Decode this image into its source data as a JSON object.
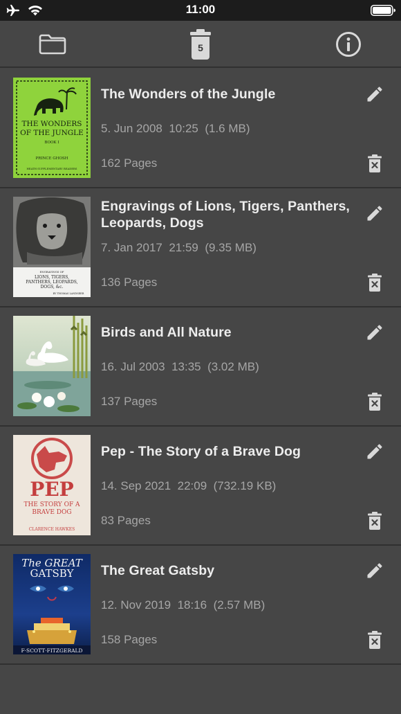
{
  "status_bar": {
    "time": "11:00",
    "icons": [
      "airplane-icon",
      "wifi-icon",
      "battery-icon"
    ]
  },
  "toolbar": {
    "folder_icon": "folder-icon",
    "trash_icon": "trash-icon",
    "trash_count": "5",
    "info_icon": "info-icon"
  },
  "books": [
    {
      "title": "The Wonders of the Jungle",
      "date": "5. Jun 2008",
      "time": "10:25",
      "size": "(1.6 MB)",
      "pages": "162 Pages",
      "cover": {
        "line1": "THE WONDERS",
        "line2": "OF THE JUNGLE",
        "line3": "BOOK I",
        "author": "PRINCE GHOSH",
        "footer": "HEATH SUPPLEMENTARY READERS"
      }
    },
    {
      "title": "Engravings of Lions, Tigers, Panthers, Leopards, Dogs",
      "date": "7. Jan 2017",
      "time": "21:59",
      "size": "(9.35 MB)",
      "pages": "136 Pages",
      "cover": {
        "line1": "ENGRAVINGS OF",
        "line2": "LIONS, TIGERS,",
        "line3": "PANTHERS, LEOPARDS,",
        "line4": "DOGS, &c.",
        "author": "BY THOMAS LANDSEER"
      }
    },
    {
      "title": "Birds and All Nature",
      "date": "16. Jul 2003",
      "time": "13:35",
      "size": "(3.02 MB)",
      "pages": "137 Pages",
      "cover": {}
    },
    {
      "title": "Pep - The Story of a Brave Dog",
      "date": "14. Sep 2021",
      "time": "22:09",
      "size": "(732.19 KB)",
      "pages": "83 Pages",
      "cover": {
        "line1": "PEP",
        "line2": "THE STORY OF A",
        "line3": "BRAVE DOG",
        "author": "CLARENCE HAWKES"
      }
    },
    {
      "title": "The Great Gatsby",
      "date": "12. Nov 2019",
      "time": "18:16",
      "size": "(2.57 MB)",
      "pages": "158 Pages",
      "cover": {
        "line1": "The GREAT",
        "line2": "GATSBY",
        "author": "F·SCOTT·FITZGERALD"
      }
    }
  ],
  "colors": {
    "background": "#464646",
    "status_bar": "#1c1c1c",
    "divider": "#303030",
    "icon": "#d9d9d9",
    "secondary_text": "#a6a6a6"
  }
}
